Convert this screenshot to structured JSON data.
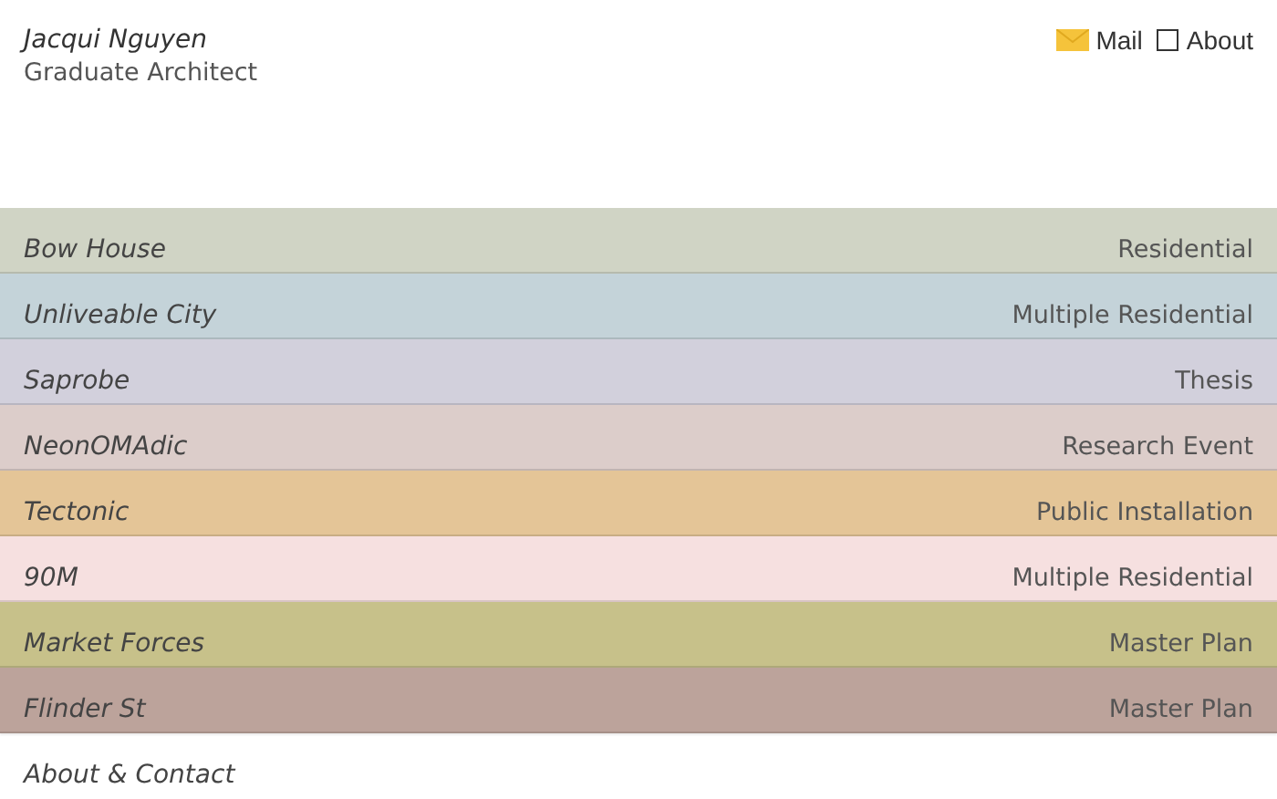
{
  "header": {
    "name": "Jacqui Nguyen",
    "role": "Graduate Architect"
  },
  "nav": [
    {
      "label": "Mail",
      "kind": "mail"
    },
    {
      "label": "About",
      "kind": "square"
    }
  ],
  "projects": [
    {
      "title": "Bow House",
      "category": "Residential",
      "color": "#d0d4c5"
    },
    {
      "title": "Unliveable City",
      "category": "Multiple Residential",
      "color": "#c4d3d9"
    },
    {
      "title": "Saprobe",
      "category": "Thesis",
      "color": "#d2d0dc"
    },
    {
      "title": "NeonOMAdic",
      "category": "Research Event",
      "color": "#dccdca"
    },
    {
      "title": "Tectonic",
      "category": "Public Installation",
      "color": "#e4c597"
    },
    {
      "title": "90M",
      "category": "Multiple Residential",
      "color": "#f6e0e0"
    },
    {
      "title": "Market Forces",
      "category": "Master Plan",
      "color": "#c7c18a"
    },
    {
      "title": "Flinder St",
      "category": "Master Plan",
      "color": "#bca39b"
    }
  ],
  "footer_link": "About & Contact"
}
